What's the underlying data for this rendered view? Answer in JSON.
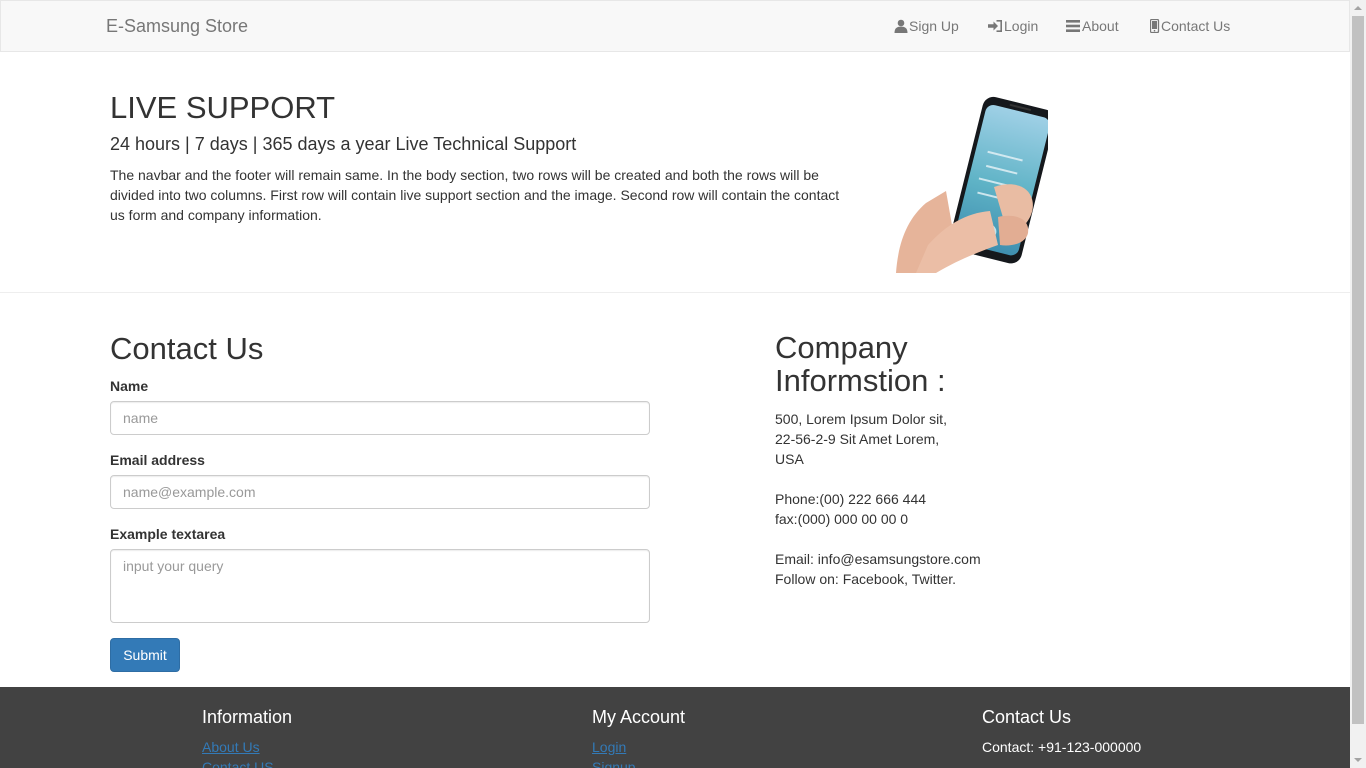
{
  "navbar": {
    "brand": "E-Samsung Store",
    "items": [
      {
        "label": "Sign Up",
        "icon": "user-icon"
      },
      {
        "label": "Login",
        "icon": "login-icon"
      },
      {
        "label": "About",
        "icon": "list-icon"
      },
      {
        "label": "Contact Us",
        "icon": "phone-icon"
      }
    ]
  },
  "hero": {
    "title": "LIVE SUPPORT",
    "subtitle": "24 hours | 7 days | 365 days a year Live Technical Support",
    "text": "The navbar and the footer will remain same. In the body section, two rows will be created and both the rows will be divided into two columns. First row will contain live support section and the image. Second row will contain the contact us form and company information."
  },
  "contact_form": {
    "title": "Contact Us",
    "name_label": "Name",
    "name_placeholder": "name",
    "email_label": "Email address",
    "email_placeholder": "name@example.com",
    "textarea_label": "Example textarea",
    "textarea_placeholder": "input your query",
    "submit_label": "Submit"
  },
  "company": {
    "title": "Company Informstion :",
    "lines": [
      "500, Lorem Ipsum Dolor sit,",
      "22-56-2-9 Sit Amet Lorem,",
      "USA",
      "",
      "Phone:(00) 222 666 444",
      "fax:(000) 000 00 00 0",
      "",
      "Email: info@esamsungstore.com",
      "Follow on: Facebook, Twitter."
    ]
  },
  "footer": {
    "columns": [
      {
        "title": "Information",
        "links": [
          "About Us",
          "Contact US"
        ]
      },
      {
        "title": "My Account",
        "links": [
          "Login",
          "Signup"
        ]
      },
      {
        "title": "Contact Us",
        "text": "Contact: +91-123-000000"
      }
    ]
  },
  "colors": {
    "link": "#337ab7",
    "footer_bg": "#424242",
    "navbar_bg": "#f8f8f8",
    "button": "#337ab7"
  }
}
